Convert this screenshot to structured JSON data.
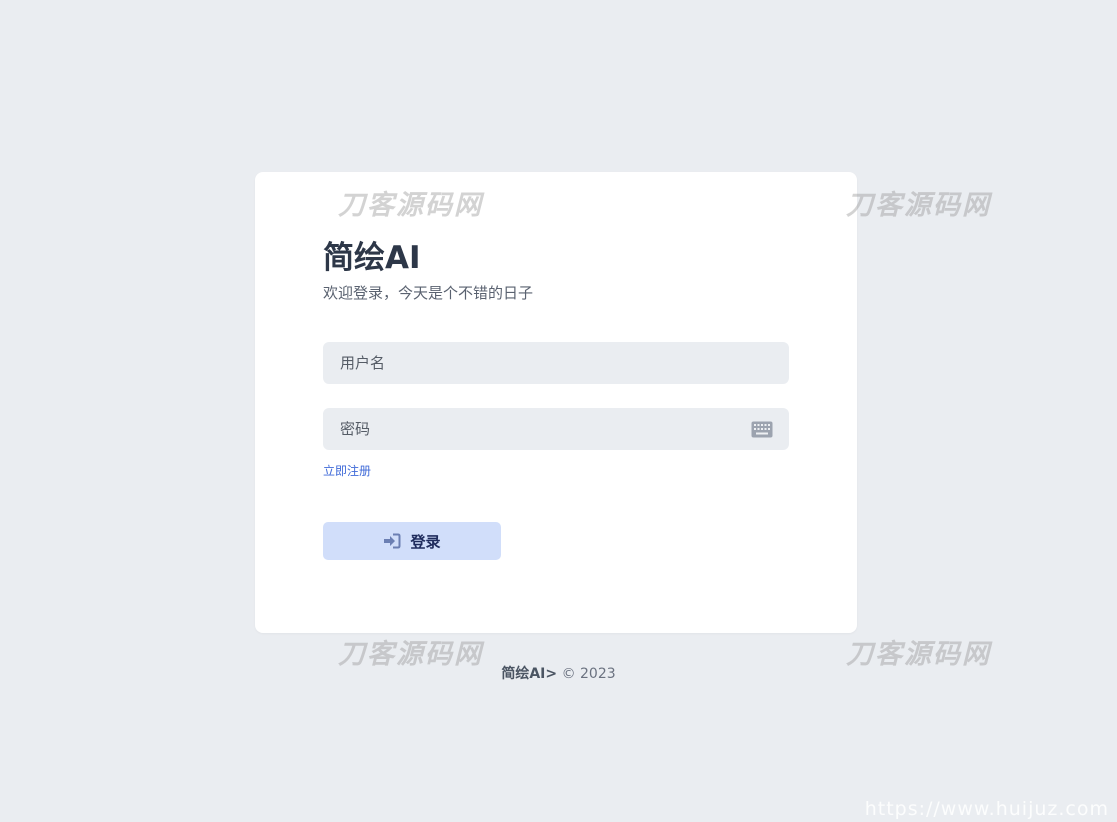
{
  "login": {
    "title": "简绘AI",
    "subtitle": "欢迎登录，今天是个不错的日子",
    "username_placeholder": "用户名",
    "password_placeholder": "密码",
    "register_link": "立即注册",
    "login_button": "登录",
    "login_icon": "sign-in-icon",
    "keyboard_icon": "keyboard-icon"
  },
  "footer": {
    "brand": "简绘AI>",
    "copyright": "© 2023"
  },
  "watermarks": {
    "site_name": "刀客源码网",
    "url": "https://www.huijuz.com"
  },
  "colors": {
    "background": "#eaedf1",
    "card": "#ffffff",
    "accent_link": "#3f6ad8",
    "button_bg": "#d1defa",
    "button_text": "#1e2b5c"
  }
}
